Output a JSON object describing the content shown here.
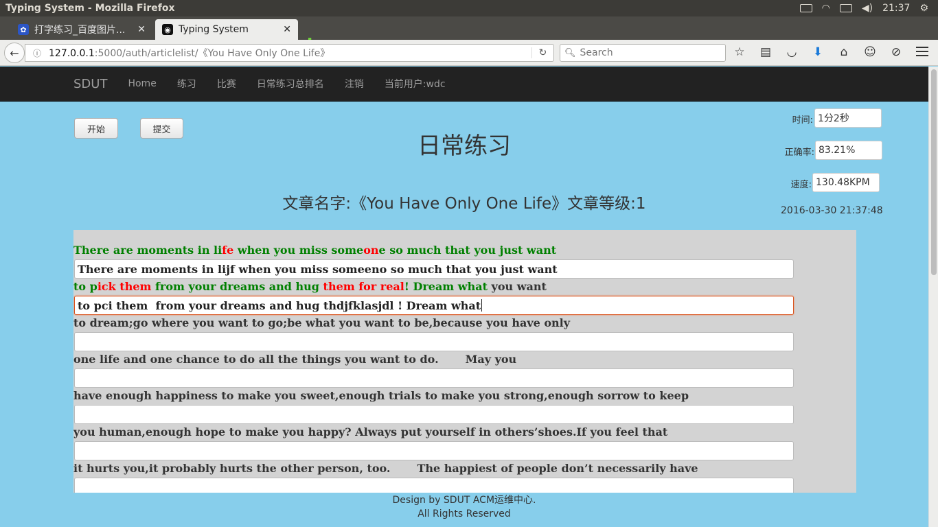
{
  "os": {
    "window_title": "Typing System - Mozilla Firefox",
    "clock": "21:37"
  },
  "browser": {
    "tabs": [
      {
        "label": "打字练习_百度图片...",
        "favicon": "paw-icon"
      },
      {
        "label": "Typing System",
        "favicon": "ubuntu-favicon"
      }
    ],
    "url_host": "127.0.0.1",
    "url_rest": ":5000/auth/articlelist/《You Have Only One Life》",
    "search_placeholder": "Search"
  },
  "site": {
    "brand": "SDUT",
    "nav": [
      "Home",
      "练习",
      "比赛",
      "日常练习总排名",
      "注销",
      "当前用户:wdc"
    ],
    "start_button": "开始",
    "submit_button": "提交",
    "page_title": "日常练习",
    "article_title": "文章名字:《You Have Only One Life》文章等级:1",
    "stats": {
      "time_label": "时间:",
      "time_value": "1分2秒",
      "accuracy_label": "正确率:",
      "accuracy_value": "83.21%",
      "speed_label": "速度:",
      "speed_value": "130.48KPM"
    },
    "timestamp": "2016-03-30 21:37:48",
    "lines": [
      {
        "segments": [
          {
            "text": "There are moments in li",
            "state": "ok"
          },
          {
            "text": "fe",
            "state": "bad"
          },
          {
            "text": " when you miss some",
            "state": "ok"
          },
          {
            "text": "on",
            "state": "bad"
          },
          {
            "text": "e",
            "state": "ok"
          },
          {
            "text": " so much that you just want",
            "state": "ok"
          }
        ],
        "typed": "There are moments in lijf when you miss someeno so much that you just want"
      },
      {
        "segments": [
          {
            "text": "to p",
            "state": "ok"
          },
          {
            "text": "i",
            "state": "bad"
          },
          {
            "text": "ck them",
            "state": "bad"
          },
          {
            "text": " from your dreams and hug ",
            "state": "ok"
          },
          {
            "text": "them for real",
            "state": "bad"
          },
          {
            "text": "! Dream what",
            "state": "ok"
          },
          {
            "text": " you want",
            "state": "none"
          }
        ],
        "typed": "to pci them  from your dreams and hug thdjfklasjdl ! Dream what"
      },
      {
        "segments": [
          {
            "text": "to dream;go where you want to go;be what you want to be,because you have only",
            "state": "none"
          }
        ],
        "typed": ""
      },
      {
        "segments": [
          {
            "text": "one life and one chance to do all the things you want to do.       May you",
            "state": "none"
          }
        ],
        "typed": ""
      },
      {
        "segments": [
          {
            "text": "have enough happiness to make you sweet,enough trials to make you strong,enough sorrow to keep",
            "state": "none"
          }
        ],
        "typed": ""
      },
      {
        "segments": [
          {
            "text": "you human,enough hope to make you happy? Always put yourself in others’shoes.If you feel that",
            "state": "none"
          }
        ],
        "typed": ""
      },
      {
        "segments": [
          {
            "text": "it hurts you,it probably hurts the other person, too.       The happiest of people don’t necessarily have",
            "state": "none"
          }
        ],
        "typed": ""
      }
    ],
    "footer_line1": "Design by SDUT ACM运维中心.",
    "footer_line2": "All Rights Reserved"
  },
  "colors": {
    "page_bg": "#87ceeb",
    "correct": "#008000",
    "wrong": "#ff0000",
    "navbar": "#222222"
  }
}
